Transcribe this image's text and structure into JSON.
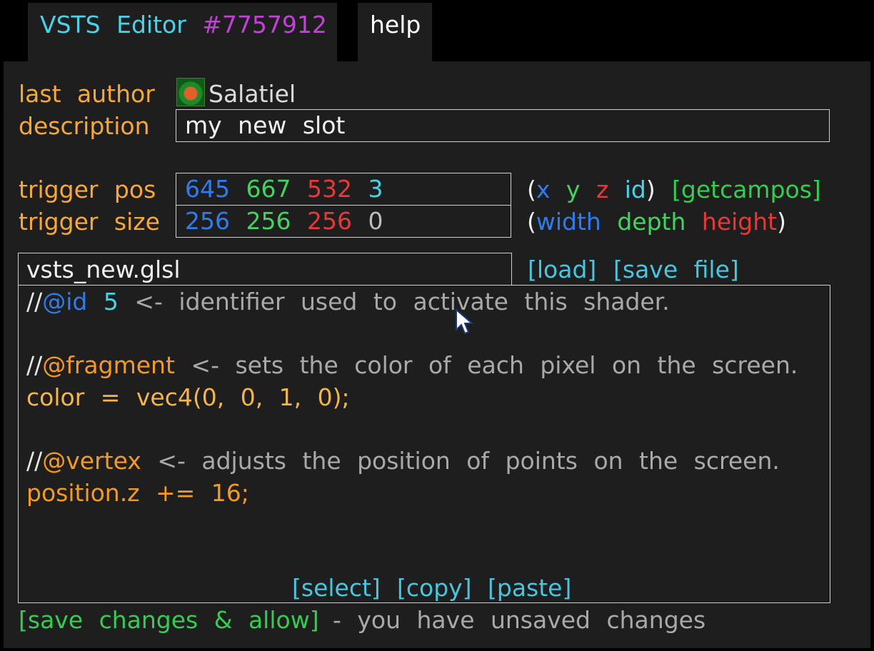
{
  "tabs": {
    "editor_label": "VSTS Editor",
    "editor_id": "#7757912",
    "help_label": "help"
  },
  "meta": {
    "last_author_label": "last author",
    "author_name": "Salatiel",
    "description_label": "description",
    "description_value": "my new slot"
  },
  "trigger": {
    "pos_label": "trigger pos",
    "pos_x": "645",
    "pos_y": "667",
    "pos_z": "532",
    "pos_id": "3",
    "size_label": "trigger size",
    "size_w": "256",
    "size_d": "256",
    "size_h": "256",
    "size_extra": "0",
    "pos_hint_open": "(",
    "pos_hint_x": "x",
    "pos_hint_y": "y",
    "pos_hint_z": "z",
    "pos_hint_id": "id",
    "pos_hint_close": ")",
    "getcampos": "[getcampos]",
    "size_hint_open": "(",
    "size_hint_width": "width",
    "size_hint_depth": "depth",
    "size_hint_height": "height",
    "size_hint_close": ")"
  },
  "file": {
    "name": "vsts_new.glsl",
    "load": "[load]",
    "save_file": "[save file]"
  },
  "code": {
    "line1_prefix": "//",
    "line1_tag": "@id",
    "line1_value": "5",
    "line1_comment": "<- identifier used to activate this shader.",
    "line3_prefix": "//",
    "line3_tag": "@fragment",
    "line3_comment": "<- sets the color of each pixel on the screen.",
    "line4": "color = vec4(0, 0, 1, 0);",
    "line6_prefix": "//",
    "line6_tag": "@vertex",
    "line6_comment": "<- adjusts the position of points on the screen.",
    "line7": "position.z += 16;"
  },
  "code_actions": {
    "select": "[select]",
    "copy": "[copy]",
    "paste": "[paste]"
  },
  "footer": {
    "save_allow": "[save changes & allow]",
    "status": "- you have unsaved changes"
  },
  "colors": {
    "label_orange": "#f7a83a",
    "accent_cyan": "#4ad3e6",
    "accent_magenta": "#c341d8",
    "x_blue": "#2f7cf0",
    "y_green": "#42d45f",
    "z_red": "#e83838",
    "panel_bg": "#1e1e1e"
  },
  "icons": {
    "avatar": "avatar-icon",
    "cursor": "mouse-pointer-icon"
  }
}
